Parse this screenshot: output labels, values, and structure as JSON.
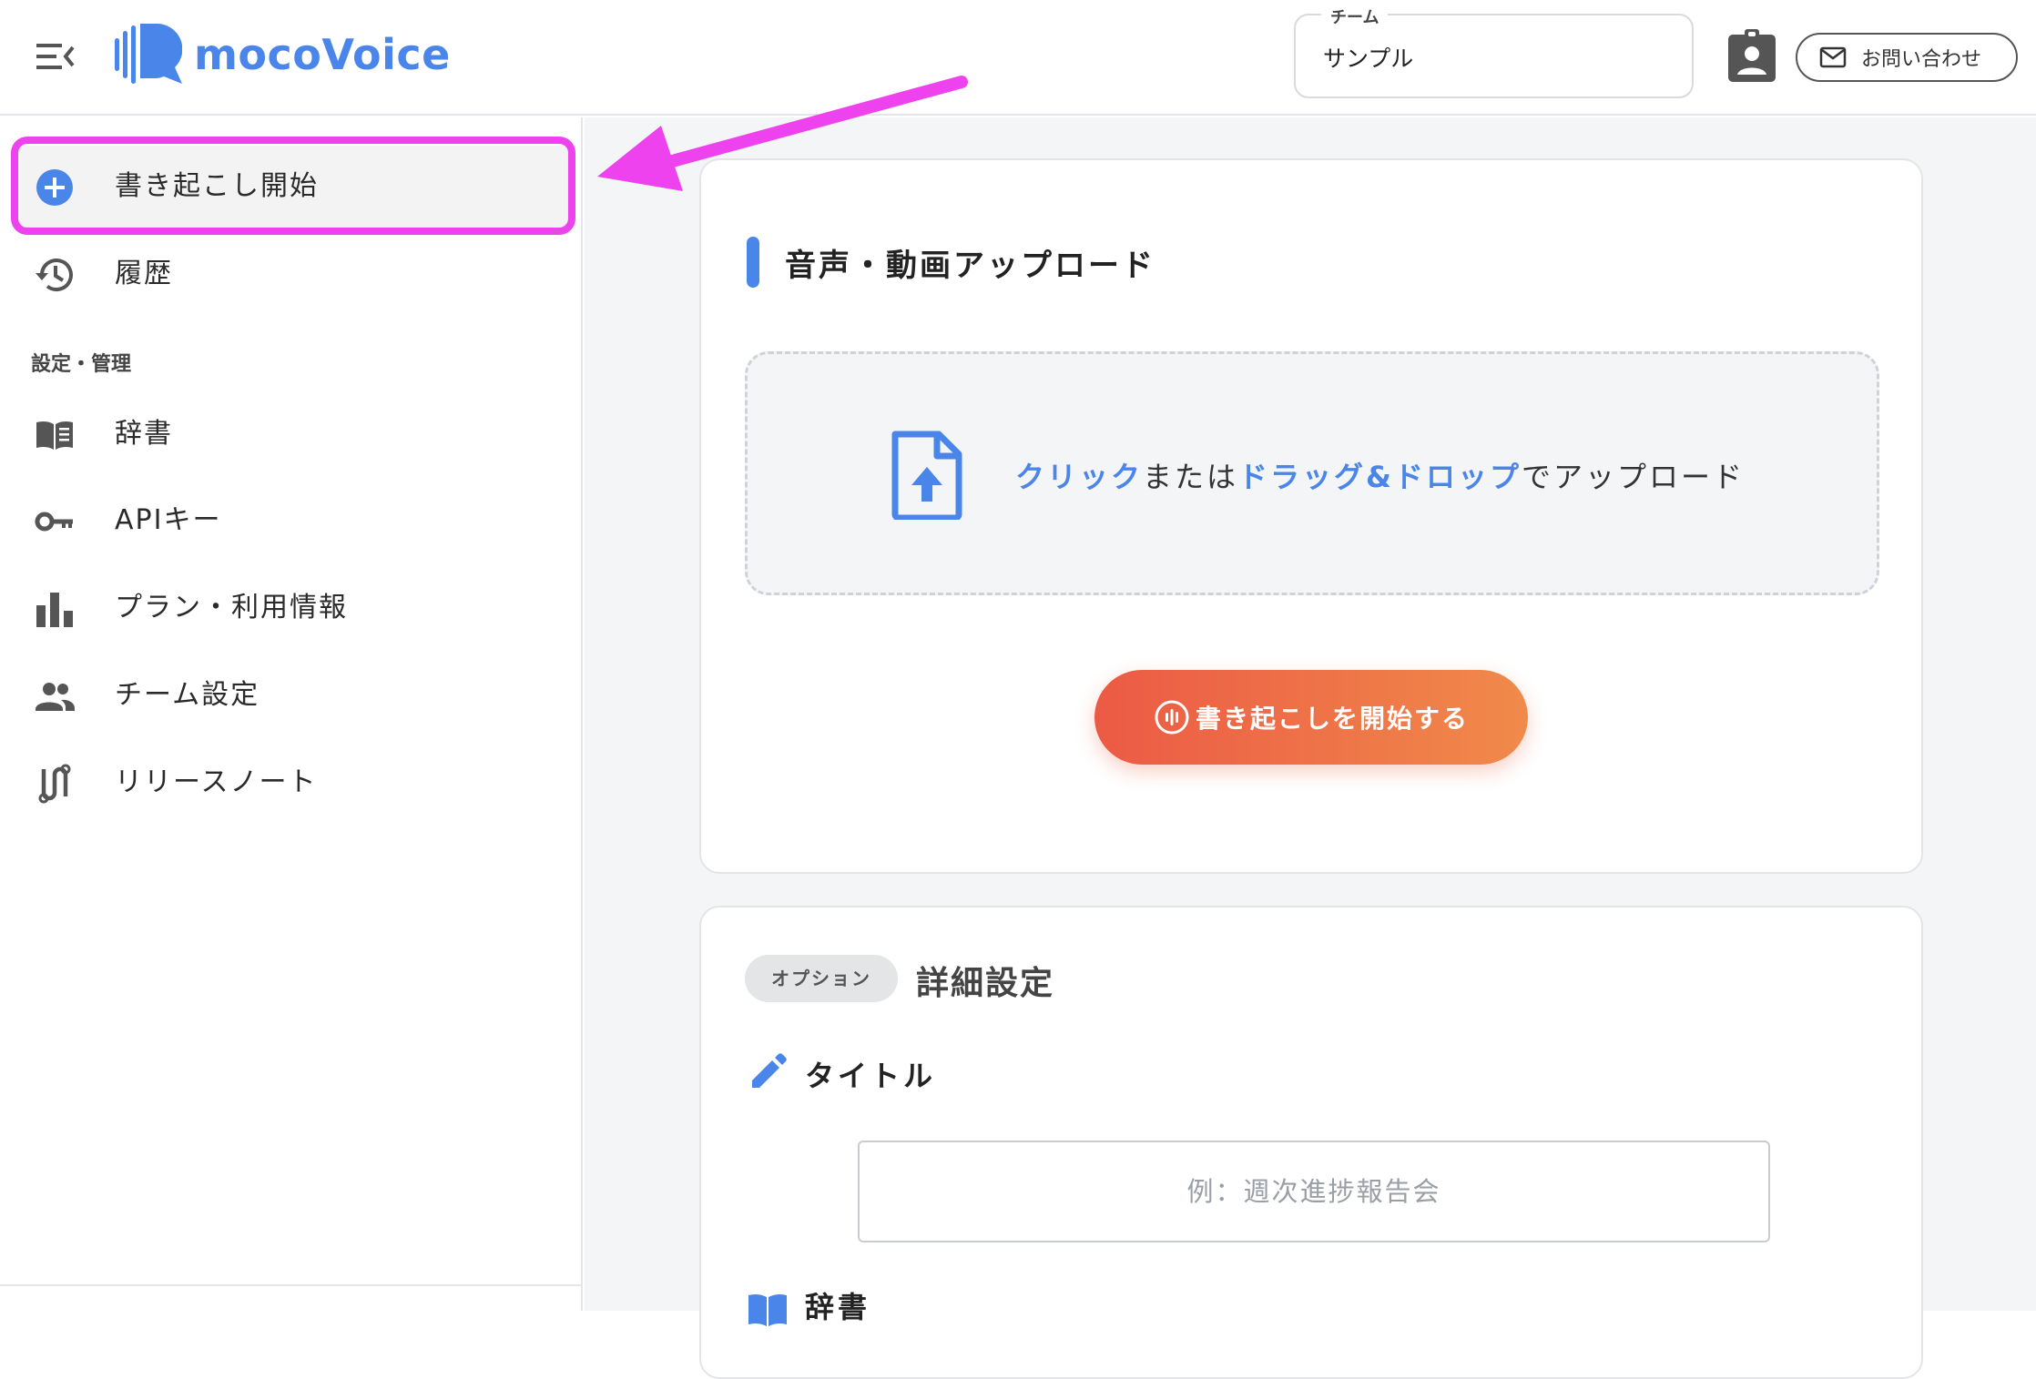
{
  "header": {
    "app_name": "mocoVoice",
    "team_select": {
      "label": "チーム",
      "value": "サンプル"
    },
    "contact_label": "お問い合わせ"
  },
  "sidebar": {
    "items": [
      {
        "label": "書き起こし開始",
        "icon": "add-circle-icon",
        "active": true
      },
      {
        "label": "履歴",
        "icon": "history-icon"
      }
    ],
    "section_label": "設定・管理",
    "settings_items": [
      {
        "label": "辞書",
        "icon": "book-icon"
      },
      {
        "label": "APIキー",
        "icon": "key-icon"
      },
      {
        "label": "プラン・利用情報",
        "icon": "bar-chart-icon"
      },
      {
        "label": "チーム設定",
        "icon": "people-icon"
      },
      {
        "label": "リリースノート",
        "icon": "route-icon"
      }
    ]
  },
  "upload": {
    "title": "音声・動画アップロード",
    "drop_text": {
      "click": "クリック",
      "or": "または",
      "drag": "ドラッグ&ドロップ",
      "suffix": "でアップロード"
    },
    "start_label": "書き起こしを開始する"
  },
  "options": {
    "badge": "オプション",
    "title": "詳細設定",
    "title_field": {
      "label": "タイトル",
      "placeholder": "例：週次進捗報告会",
      "value": ""
    },
    "dictionary_label": "辞書"
  },
  "colors": {
    "accent": "#4a86ea",
    "highlight": "#ee42ee",
    "button_start": "#ec5a45",
    "button_end": "#f08a4a"
  }
}
